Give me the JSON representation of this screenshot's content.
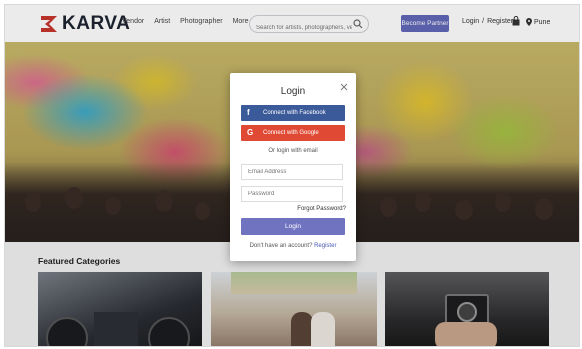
{
  "brand": {
    "logo_text": "KARVA",
    "logo_color": "#c8362d"
  },
  "nav": {
    "items": [
      "Vendor",
      "Artist",
      "Photographer",
      "More"
    ]
  },
  "search": {
    "placeholder": "Search for artists, photographers, venues"
  },
  "header": {
    "become_partner": "Become Partner",
    "login": "Login",
    "separator": "/",
    "register": "Register",
    "city": "Pune"
  },
  "categories": {
    "title": "Featured Categories"
  },
  "login_modal": {
    "title": "Login",
    "facebook_label": "Connect with Facebook",
    "google_label": "Connect with Google",
    "facebook_icon_glyph": "f",
    "google_icon_glyph": "G",
    "or_text": "Or login with email",
    "email_placeholder": "Email Address",
    "password_placeholder": "Password",
    "forgot": "Forgot Password?",
    "login_button": "Login",
    "signup_prompt": "Don't have an account?",
    "register_link": "Register"
  },
  "colors": {
    "accent": "#6268b8",
    "facebook": "#3b5a9a",
    "google": "#e04a35",
    "login_button": "#7073c0"
  }
}
